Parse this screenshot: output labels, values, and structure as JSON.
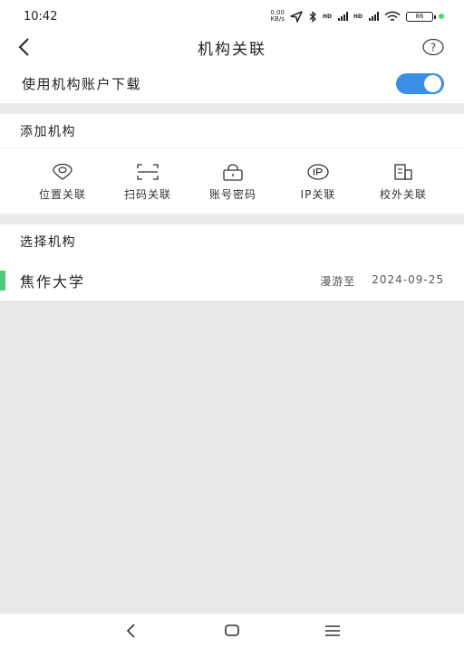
{
  "status_bar": {
    "time": "10:42",
    "net_speed_value": "0.00",
    "net_speed_unit": "KB/s",
    "network_label_1": "HD",
    "network_label_2": "HD",
    "battery": "86"
  },
  "nav": {
    "title": "机构关联",
    "help": "?"
  },
  "toggle": {
    "label": "使用机构账户下载",
    "enabled": true
  },
  "add_section": {
    "title": "添加机构",
    "methods": [
      {
        "label": "位置关联",
        "icon": "location-pin-icon"
      },
      {
        "label": "扫码关联",
        "icon": "scan-icon"
      },
      {
        "label": "账号密码",
        "icon": "lock-icon"
      },
      {
        "label": "IP关联",
        "icon": "ip-icon"
      },
      {
        "label": "校外关联",
        "icon": "building-icon"
      }
    ]
  },
  "select_section": {
    "title": "选择机构",
    "institution": {
      "name": "焦作大学",
      "status": "漫游至",
      "date": "2024-09-25"
    }
  },
  "colors": {
    "accent": "#3a8ee6",
    "marker": "#55c77a",
    "background": "#e9e9ec"
  }
}
